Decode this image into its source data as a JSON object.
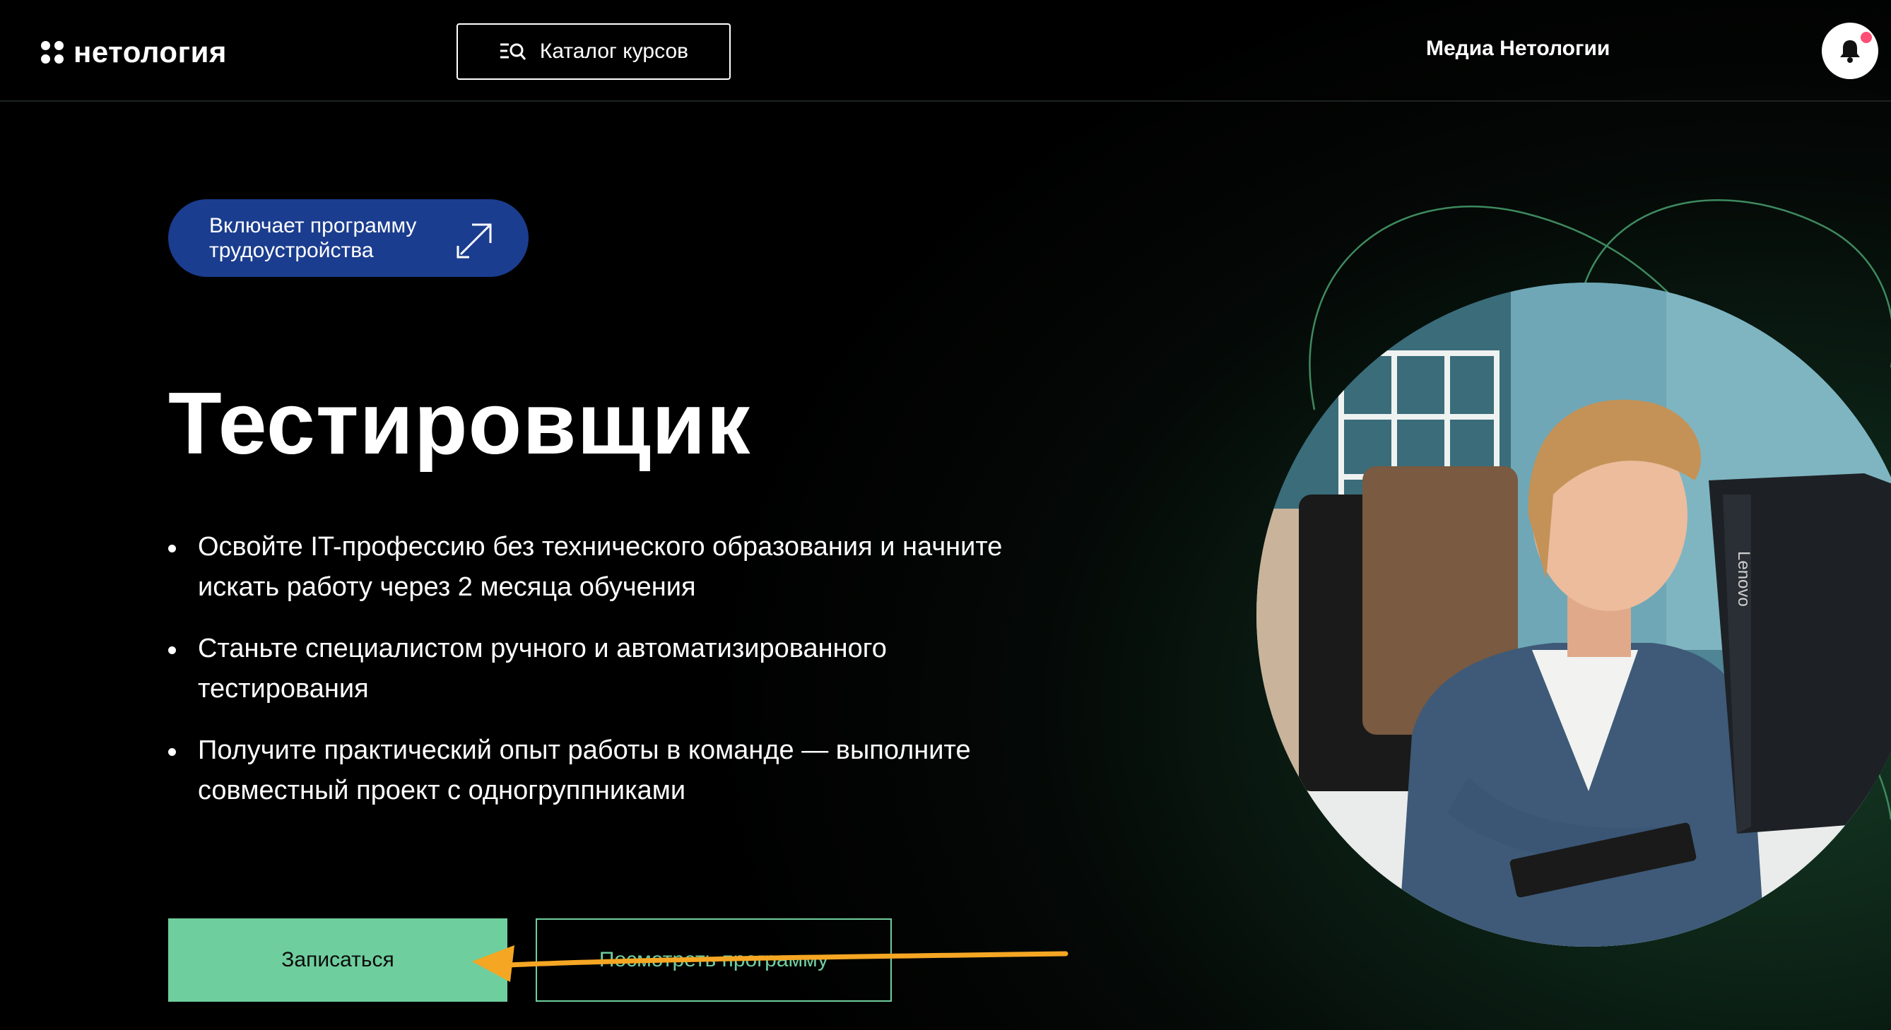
{
  "header": {
    "logo_text": "нетология",
    "catalog_label": "Каталог курсов",
    "media_link": "Медиа Нетологии"
  },
  "badge": {
    "text": "Включает программу трудоустройства"
  },
  "hero": {
    "title": "Тестировщик",
    "bullets": [
      "Освойте IT-профессию без технического образования и начните искать работу через 2 месяца обучения",
      "Станьте специалистом ручного и автоматизированного тестирования",
      "Получите практический опыт работы в команде — выполните совместный проект с одногруппниками"
    ],
    "enroll_label": "Записаться",
    "program_label": "Посмотреть программу"
  },
  "photo": {
    "monitor_brand": "Lenovo"
  },
  "colors": {
    "accent_green": "#6fce9e",
    "badge_blue": "#1b3d8f",
    "annotation_arrow": "#f5a623",
    "notification_dot": "#ff4d73"
  }
}
